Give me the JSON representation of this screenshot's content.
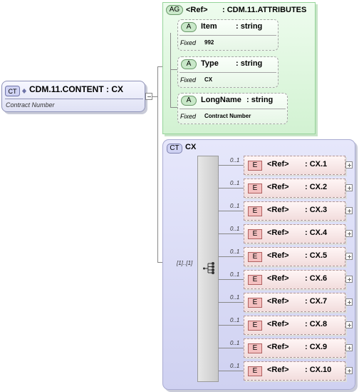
{
  "root": {
    "badge": "CT",
    "title": "CDM.11.CONTENT : CX",
    "description": "Contract Number"
  },
  "attribute_group": {
    "badge": "AG",
    "ref": "<Ref>",
    "name": ": CDM.11.ATTRIBUTES",
    "attributes": [
      {
        "badge": "A",
        "name": "Item",
        "type": ": string",
        "fixed_label": "Fixed",
        "fixed_value": "992"
      },
      {
        "badge": "A",
        "name": "Type",
        "type": ": string",
        "fixed_label": "Fixed",
        "fixed_value": "CX"
      },
      {
        "badge": "A",
        "name": "LongName",
        "type": ": string",
        "fixed_label": "Fixed",
        "fixed_value": "Contract Number"
      }
    ]
  },
  "complex_type": {
    "badge": "CT",
    "name": "CX",
    "sequence_cardinality": "[1]..[1]",
    "elements": [
      {
        "cardinality": "0..1",
        "badge": "E",
        "ref": "<Ref>",
        "name": ": CX.1"
      },
      {
        "cardinality": "0..1",
        "badge": "E",
        "ref": "<Ref>",
        "name": ": CX.2"
      },
      {
        "cardinality": "0..1",
        "badge": "E",
        "ref": "<Ref>",
        "name": ": CX.3"
      },
      {
        "cardinality": "0..1",
        "badge": "E",
        "ref": "<Ref>",
        "name": ": CX.4"
      },
      {
        "cardinality": "0..1",
        "badge": "E",
        "ref": "<Ref>",
        "name": ": CX.5"
      },
      {
        "cardinality": "0..1",
        "badge": "E",
        "ref": "<Ref>",
        "name": ": CX.6"
      },
      {
        "cardinality": "0..1",
        "badge": "E",
        "ref": "<Ref>",
        "name": ": CX.7"
      },
      {
        "cardinality": "0..1",
        "badge": "E",
        "ref": "<Ref>",
        "name": ": CX.8"
      },
      {
        "cardinality": "0..1",
        "badge": "E",
        "ref": "<Ref>",
        "name": ": CX.9"
      },
      {
        "cardinality": "0..1",
        "badge": "E",
        "ref": "<Ref>",
        "name": ": CX.10"
      }
    ]
  },
  "colors": {
    "complex_type_fill": "#dfe1f4",
    "attribute_group_fill": "#d2f2d2",
    "element_fill": "#f2dddd"
  }
}
